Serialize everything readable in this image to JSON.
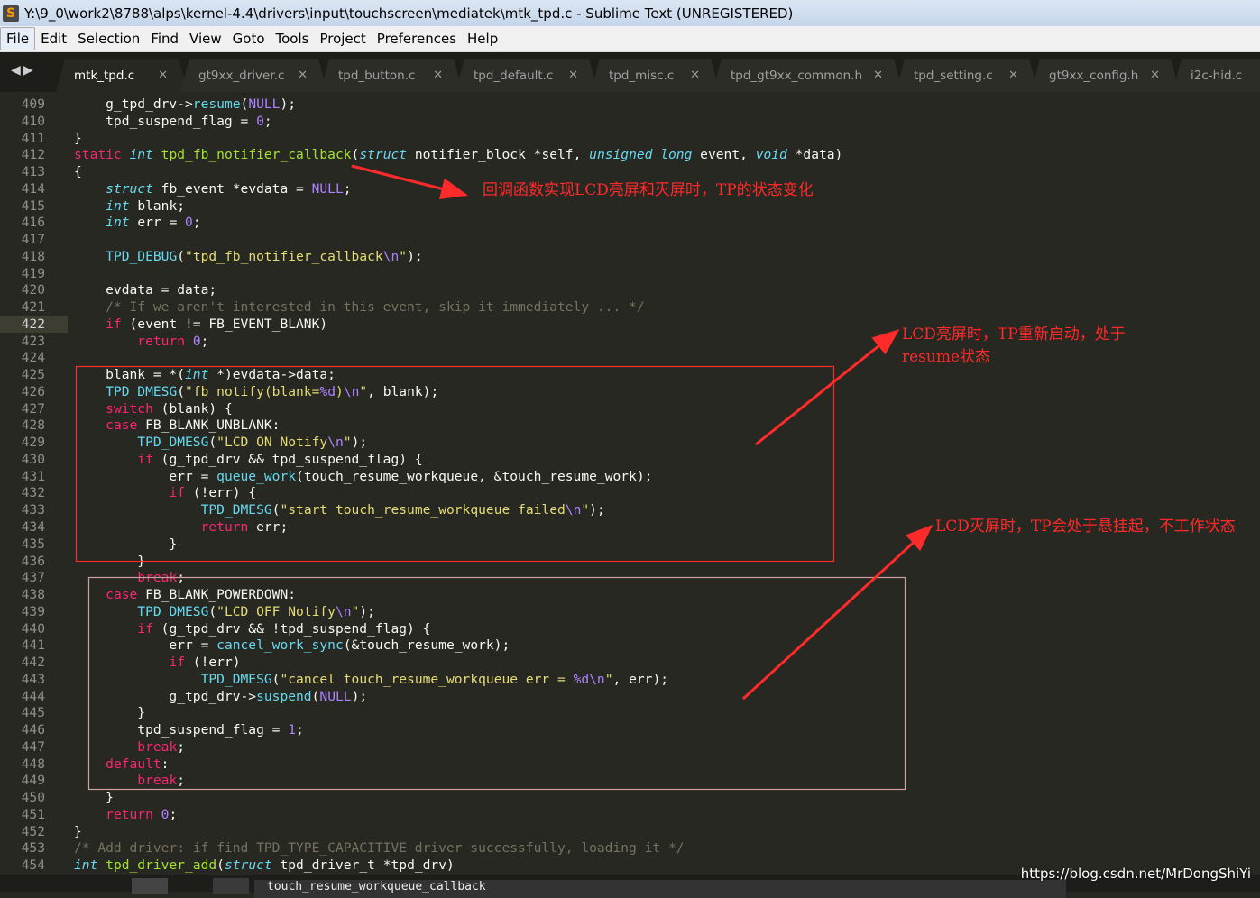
{
  "window": {
    "title": "Y:\\9_0\\work2\\8788\\alps\\kernel-4.4\\drivers\\input\\touchscreen\\mediatek\\mtk_tpd.c - Sublime Text (UNREGISTERED)",
    "logo": "S"
  },
  "menu": [
    "File",
    "Edit",
    "Selection",
    "Find",
    "View",
    "Goto",
    "Tools",
    "Project",
    "Preferences",
    "Help"
  ],
  "tabs": [
    {
      "label": "mtk_tpd.c",
      "active": true
    },
    {
      "label": "gt9xx_driver.c"
    },
    {
      "label": "tpd_button.c"
    },
    {
      "label": "tpd_default.c"
    },
    {
      "label": "tpd_misc.c"
    },
    {
      "label": "tpd_gt9xx_common.h"
    },
    {
      "label": "tpd_setting.c"
    },
    {
      "label": "gt9xx_config.h"
    },
    {
      "label": "i2c-hid.c"
    }
  ],
  "colors": {
    "keyword": "#f92672",
    "type": "#66d9ef",
    "function": "#a6e22e",
    "string": "#e6db74",
    "number": "#ae81ff",
    "comment": "#75715e",
    "annotation": "#ff2a2a"
  },
  "editor": {
    "current_line": 422,
    "first_line": 409,
    "lines": [
      [
        [
          "p",
          "    g_tpd_drv->"
        ],
        [
          "ca",
          "resume"
        ],
        [
          "p",
          "("
        ],
        [
          "nu",
          "NULL"
        ],
        [
          "p",
          ");"
        ]
      ],
      [
        [
          "p",
          "    tpd_suspend_flag = "
        ],
        [
          "nu",
          "0"
        ],
        [
          "p",
          ";"
        ]
      ],
      [
        [
          "p",
          "}"
        ]
      ],
      [
        [
          "kw",
          "static "
        ],
        [
          "ty",
          "int "
        ],
        [
          "fn",
          "tpd_fb_notifier_callback"
        ],
        [
          "p",
          "("
        ],
        [
          "ty",
          "struct "
        ],
        [
          "p",
          "notifier_block *self, "
        ],
        [
          "ty",
          "unsigned long "
        ],
        [
          "p",
          "event, "
        ],
        [
          "ty",
          "void "
        ],
        [
          "p",
          "*data)"
        ]
      ],
      [
        [
          "p",
          "{"
        ]
      ],
      [
        [
          "p",
          "    "
        ],
        [
          "ty",
          "struct "
        ],
        [
          "p",
          "fb_event *evdata = "
        ],
        [
          "nu",
          "NULL"
        ],
        [
          "p",
          ";"
        ]
      ],
      [
        [
          "p",
          "    "
        ],
        [
          "ty",
          "int "
        ],
        [
          "p",
          "blank;"
        ]
      ],
      [
        [
          "p",
          "    "
        ],
        [
          "ty",
          "int "
        ],
        [
          "p",
          "err = "
        ],
        [
          "nu",
          "0"
        ],
        [
          "p",
          ";"
        ]
      ],
      [],
      [
        [
          "p",
          "    "
        ],
        [
          "ca",
          "TPD_DEBUG"
        ],
        [
          "p",
          "("
        ],
        [
          "st",
          "\"tpd_fb_notifier_callback"
        ],
        [
          "es",
          "\\n"
        ],
        [
          "st",
          "\""
        ],
        [
          "p",
          ");"
        ]
      ],
      [],
      [
        [
          "p",
          "    evdata = data;"
        ]
      ],
      [
        [
          "cm",
          "    /* If we aren't interested in this event, skip it immediately ... */"
        ]
      ],
      [
        [
          "p",
          "    "
        ],
        [
          "kw",
          "if "
        ],
        [
          "p",
          "(event != FB_EVENT_BLANK)"
        ]
      ],
      [
        [
          "p",
          "        "
        ],
        [
          "kw",
          "return "
        ],
        [
          "nu",
          "0"
        ],
        [
          "p",
          ";"
        ]
      ],
      [],
      [
        [
          "p",
          "    blank = *("
        ],
        [
          "ty",
          "int "
        ],
        [
          "p",
          "*)evdata->data;"
        ]
      ],
      [
        [
          "p",
          "    "
        ],
        [
          "ca",
          "TPD_DMESG"
        ],
        [
          "p",
          "("
        ],
        [
          "st",
          "\"fb_notify(blank="
        ],
        [
          "es",
          "%d"
        ],
        [
          "st",
          ")"
        ],
        [
          "es",
          "\\n"
        ],
        [
          "st",
          "\""
        ],
        [
          "p",
          ", blank);"
        ]
      ],
      [
        [
          "p",
          "    "
        ],
        [
          "kw",
          "switch "
        ],
        [
          "p",
          "(blank) {"
        ]
      ],
      [
        [
          "p",
          "    "
        ],
        [
          "kw",
          "case "
        ],
        [
          "p",
          "FB_BLANK_UNBLANK:"
        ]
      ],
      [
        [
          "p",
          "        "
        ],
        [
          "ca",
          "TPD_DMESG"
        ],
        [
          "p",
          "("
        ],
        [
          "st",
          "\"LCD ON Notify"
        ],
        [
          "es",
          "\\n"
        ],
        [
          "st",
          "\""
        ],
        [
          "p",
          ");"
        ]
      ],
      [
        [
          "p",
          "        "
        ],
        [
          "kw",
          "if "
        ],
        [
          "p",
          "(g_tpd_drv && tpd_suspend_flag) {"
        ]
      ],
      [
        [
          "p",
          "            err = "
        ],
        [
          "ca",
          "queue_work"
        ],
        [
          "p",
          "(touch_resume_workqueue, &touch_resume_work);"
        ]
      ],
      [
        [
          "p",
          "            "
        ],
        [
          "kw",
          "if "
        ],
        [
          "p",
          "(!err) {"
        ]
      ],
      [
        [
          "p",
          "                "
        ],
        [
          "ca",
          "TPD_DMESG"
        ],
        [
          "p",
          "("
        ],
        [
          "st",
          "\"start touch_resume_workqueue failed"
        ],
        [
          "es",
          "\\n"
        ],
        [
          "st",
          "\""
        ],
        [
          "p",
          ");"
        ]
      ],
      [
        [
          "p",
          "                "
        ],
        [
          "kw",
          "return "
        ],
        [
          "p",
          "err;"
        ]
      ],
      [
        [
          "p",
          "            }"
        ]
      ],
      [
        [
          "p",
          "        }"
        ]
      ],
      [
        [
          "p",
          "        "
        ],
        [
          "kw",
          "break"
        ],
        [
          "p",
          ";"
        ]
      ],
      [
        [
          "p",
          "    "
        ],
        [
          "kw",
          "case "
        ],
        [
          "p",
          "FB_BLANK_POWERDOWN:"
        ]
      ],
      [
        [
          "p",
          "        "
        ],
        [
          "ca",
          "TPD_DMESG"
        ],
        [
          "p",
          "("
        ],
        [
          "st",
          "\"LCD OFF Notify"
        ],
        [
          "es",
          "\\n"
        ],
        [
          "st",
          "\""
        ],
        [
          "p",
          ");"
        ]
      ],
      [
        [
          "p",
          "        "
        ],
        [
          "kw",
          "if "
        ],
        [
          "p",
          "(g_tpd_drv && !tpd_suspend_flag) {"
        ]
      ],
      [
        [
          "p",
          "            err = "
        ],
        [
          "ca",
          "cancel_work_sync"
        ],
        [
          "p",
          "(&touch_resume_work);"
        ]
      ],
      [
        [
          "p",
          "            "
        ],
        [
          "kw",
          "if "
        ],
        [
          "p",
          "(!err)"
        ]
      ],
      [
        [
          "p",
          "                "
        ],
        [
          "ca",
          "TPD_DMESG"
        ],
        [
          "p",
          "("
        ],
        [
          "st",
          "\"cancel touch_resume_workqueue err = "
        ],
        [
          "es",
          "%d\\n"
        ],
        [
          "st",
          "\""
        ],
        [
          "p",
          ", err);"
        ]
      ],
      [
        [
          "p",
          "            g_tpd_drv->"
        ],
        [
          "ca",
          "suspend"
        ],
        [
          "p",
          "("
        ],
        [
          "nu",
          "NULL"
        ],
        [
          "p",
          ");"
        ]
      ],
      [
        [
          "p",
          "        }"
        ]
      ],
      [
        [
          "p",
          "        tpd_suspend_flag = "
        ],
        [
          "nu",
          "1"
        ],
        [
          "p",
          ";"
        ]
      ],
      [
        [
          "p",
          "        "
        ],
        [
          "kw",
          "break"
        ],
        [
          "p",
          ";"
        ]
      ],
      [
        [
          "p",
          "    "
        ],
        [
          "kw",
          "default"
        ],
        [
          "p",
          ":"
        ]
      ],
      [
        [
          "p",
          "        "
        ],
        [
          "kw",
          "break"
        ],
        [
          "p",
          ";"
        ]
      ],
      [
        [
          "p",
          "    }"
        ]
      ],
      [
        [
          "p",
          "    "
        ],
        [
          "kw",
          "return "
        ],
        [
          "nu",
          "0"
        ],
        [
          "p",
          ";"
        ]
      ],
      [
        [
          "p",
          "}"
        ]
      ],
      [
        [
          "cm",
          "/* Add driver: if find TPD_TYPE_CAPACITIVE driver successfully, loading it */"
        ]
      ],
      [
        [
          "ty",
          "int "
        ],
        [
          "fn",
          "tpd_driver_add"
        ],
        [
          "p",
          "("
        ],
        [
          "ty",
          "struct "
        ],
        [
          "p",
          "tpd_driver_t *tpd_drv)"
        ]
      ]
    ]
  },
  "annotations": {
    "callback_note": "回调函数实现LCD亮屏和灭屏时，TP的状态变化",
    "unblank_note": "LCD亮屏时，TP重新启动，处于resume状态",
    "powerdown_note": "LCD灭屏时，TP会处于悬挂起，不工作状态"
  },
  "statusbar": {
    "find_text": "touch_resume_workqueue_callback"
  },
  "watermark": "https://blog.csdn.net/MrDongShiYi"
}
